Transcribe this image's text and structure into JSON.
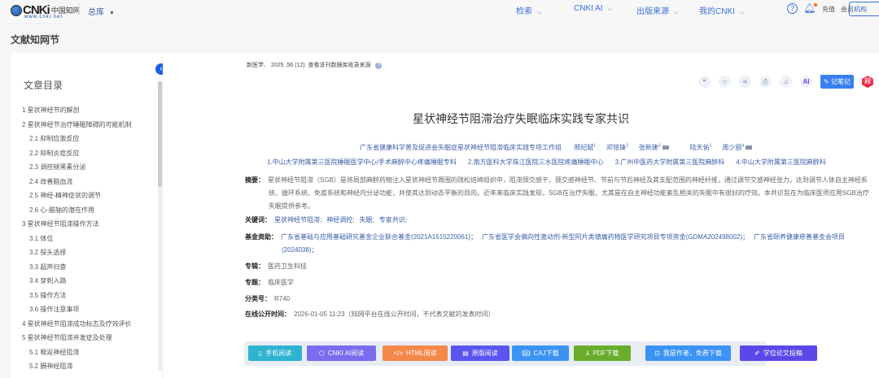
{
  "nav": {
    "logo_text": "CNKi",
    "logo_cn": "中国知网",
    "logo_url": "www.cnki.net",
    "library": "总库",
    "items": [
      "检索",
      "CNKI AI",
      "出版来源",
      "我的CNKI"
    ],
    "recharge": "充值",
    "member": "会员",
    "institution": "机构"
  },
  "page_title": "文献知网节",
  "toc": {
    "heading": "文章目录",
    "items": [
      {
        "label": "1 星状神经节的解剖",
        "level": 1
      },
      {
        "label": "2 星状神经节治疗睡眠障碍的可能机制",
        "level": 1
      },
      {
        "label": "2.1 抑制应激反应",
        "level": 2
      },
      {
        "label": "2.2 抑制炎症反应",
        "level": 2
      },
      {
        "label": "2.3 调控褪黑素分泌",
        "level": 2
      },
      {
        "label": "2.4 改善脑血流",
        "level": 2
      },
      {
        "label": "2.5 神经-精神症状的调节",
        "level": 2
      },
      {
        "label": "2.6 心-脑轴的潜在作用",
        "level": 2
      },
      {
        "label": "3 星状神经节阻滞操作方法",
        "level": 1
      },
      {
        "label": "3.1 体位",
        "level": 2
      },
      {
        "label": "3.2 探头选择",
        "level": 2
      },
      {
        "label": "3.3 超声扫查",
        "level": 2
      },
      {
        "label": "3.4 穿刺入路",
        "level": 2
      },
      {
        "label": "3.5 操作方法",
        "level": 2
      },
      {
        "label": "3.6 操作注意事项",
        "level": 2
      },
      {
        "label": "4 星状神经节阻滞成功标志及疗效评价",
        "level": 1
      },
      {
        "label": "5 星状神经节阻滞并发症及处理",
        "level": 1
      },
      {
        "label": "5.1 喉返神经阻滞",
        "level": 2
      },
      {
        "label": "5.2 膈神经阻滞",
        "level": 2
      }
    ]
  },
  "article": {
    "source": "新医学． 2025 ,56 (12)",
    "source_link": "查看该刊数据库收录来源",
    "tools": {
      "note": "记笔记",
      "ai": "AI",
      "translate": "释"
    },
    "title": "星状神经节阻滞治疗失眠临床实践专家共识",
    "group": "广东省健康科学普及促进会失眠症星状神经节阻滞临床实践专项工作组",
    "authors": [
      {
        "name": "邢纪斌",
        "sup": "1"
      },
      {
        "name": "邓铭锋",
        "sup": "2"
      },
      {
        "name": "张新建",
        "sup": "3"
      },
      {
        "name": "陆天佑",
        "sup": "1"
      },
      {
        "name": "周少丽",
        "sup": "4"
      }
    ],
    "affiliations": [
      "1.中山大学附属第三医院睡眠医学中心/手术麻醉中心疼痛睡眠专科",
      "2.南方医科大学珠江医院三水医院疼痛睡眠中心",
      "3.广州中医药大学附属第三医院麻醉科",
      "4.中山大学附属第三医院麻醉科"
    ],
    "abstract_label": "摘要：",
    "abstract": "星状神经节阻滞（SGB）是将局部麻醉药物注入星状神经节周围的疏松结缔组织中，阻滞颈交感干、颈交感神经节、节前与节后神经及其支配范围的神经纤维，通过调节交感神经张力，达到调节人体自主神经系统、循环系统、免疫系统和神经内分泌功能，并使其达到动态平衡的目的。近年来临床实践发现，SGB在治疗失眠，尤其是在自主神经功能紊乱相关的失眠中有很好的疗效。本共识旨在为临床医师应用SGB治疗失眠提供参考。",
    "keywords_label": "关键词：",
    "keywords": [
      "星状神经节阻滞;",
      "神经调控;",
      "失眠;",
      "专家共识;"
    ],
    "fund_label": "基金资助：",
    "funds": [
      "广东省基础与应用基础研究基金企业联合基金(2021A1515220061)；",
      "广东省医学会偏向性激动剂-新型阿片类镇痛药物医学研究项目专项资金(GDMA202498002)；",
      "广东省颐养健康慈善基金会项目(2024038)；"
    ],
    "series_label": "专辑：",
    "series": "医药卫生科技",
    "topic_label": "专题：",
    "topic": "临床医学",
    "class_label": "分类号：",
    "class": "R740",
    "pub_label": "在线公开时间：",
    "pub": "2026-01-05 11:23（知网平台在线公开时间，不代表文献的发表时间）"
  },
  "actions": [
    {
      "label": "手机阅读",
      "color": "#2fb3d3"
    },
    {
      "label": "CNKI AI阅读",
      "color": "#7a6cf0"
    },
    {
      "label": "HTML阅读",
      "color": "#f5894a"
    },
    {
      "label": "原版阅读",
      "color": "#5a54f0"
    },
    {
      "label": "CAJ下载",
      "color": "#3a93f5"
    },
    {
      "label": "PDF下载",
      "color": "#6aac2c"
    },
    {
      "label": "我是作者，免费下载",
      "color": "#3a93f5"
    },
    {
      "label": "学位论文投稿",
      "color": "#5a48e8"
    }
  ]
}
